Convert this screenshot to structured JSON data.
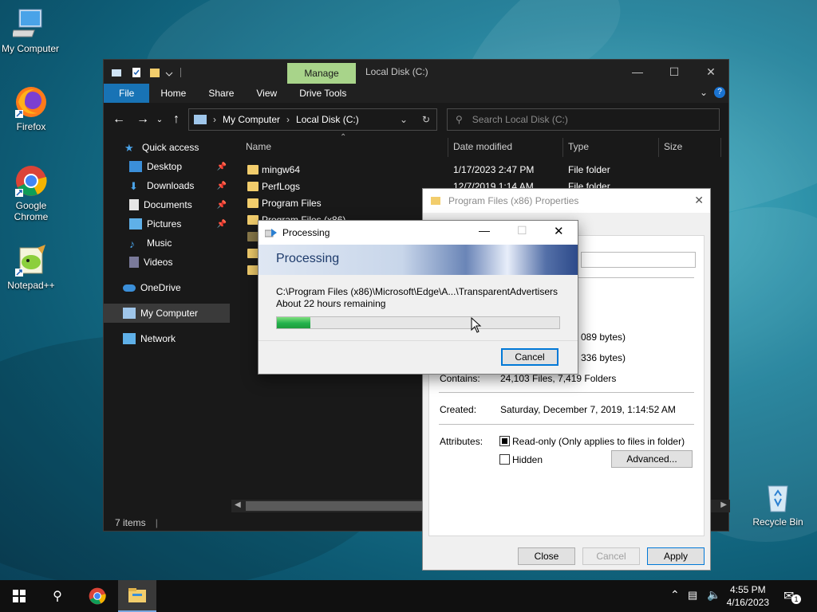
{
  "desktop": {
    "icons": [
      {
        "label": "My Computer"
      },
      {
        "label": "Firefox"
      },
      {
        "label": "Google Chrome"
      },
      {
        "label": "Notepad++"
      },
      {
        "label": "Recycle Bin"
      }
    ]
  },
  "explorer": {
    "manage_tab": "Manage",
    "title": "Local Disk (C:)",
    "ribbon_tabs": [
      "File",
      "Home",
      "Share",
      "View",
      "Drive Tools"
    ],
    "address": {
      "crumb1": "My Computer",
      "crumb2": "Local Disk (C:)"
    },
    "search": {
      "placeholder": "Search Local Disk (C:)"
    },
    "sidebar": [
      {
        "label": "Quick access"
      },
      {
        "label": "Desktop"
      },
      {
        "label": "Downloads"
      },
      {
        "label": "Documents"
      },
      {
        "label": "Pictures"
      },
      {
        "label": "Music"
      },
      {
        "label": "Videos"
      },
      {
        "label": "OneDrive"
      },
      {
        "label": "My Computer"
      },
      {
        "label": "Network"
      }
    ],
    "columns": {
      "name": "Name",
      "date": "Date modified",
      "type": "Type",
      "size": "Size"
    },
    "files": [
      {
        "name": "mingw64",
        "date": "1/17/2023 2:47 PM",
        "type": "File folder"
      },
      {
        "name": "PerfLogs",
        "date": "12/7/2019 1:14 AM",
        "type": "File folder"
      },
      {
        "name": "Program Files",
        "date": "",
        "type": ""
      },
      {
        "name": "Program Files (x86)",
        "date": "",
        "type": ""
      }
    ],
    "status": "7 items"
  },
  "properties": {
    "title": "Program Files (x86) Properties",
    "size_tail": "089 bytes)",
    "size_on_disk_tail": "336 bytes)",
    "contains_label": "Contains:",
    "contains_value": "24,103 Files, 7,419 Folders",
    "created_label": "Created:",
    "created_value": "Saturday, December 7, 2019, 1:14:52 AM",
    "attributes_label": "Attributes:",
    "readonly_label": "Read-only (Only applies to files in folder)",
    "hidden_label": "Hidden",
    "advanced_button": "Advanced...",
    "ok_button": "Close",
    "cancel_button": "Cancel",
    "apply_button": "Apply"
  },
  "processing": {
    "title": "Processing",
    "heading": "Processing",
    "path": "C:\\Program Files (x86)\\Microsoft\\Edge\\A...\\TransparentAdvertisers",
    "remaining": "About 22 hours remaining",
    "progress_percent": 12,
    "cancel_button": "Cancel"
  },
  "taskbar": {
    "time": "4:55 PM",
    "date": "4/16/2023",
    "notification_count": "1"
  }
}
